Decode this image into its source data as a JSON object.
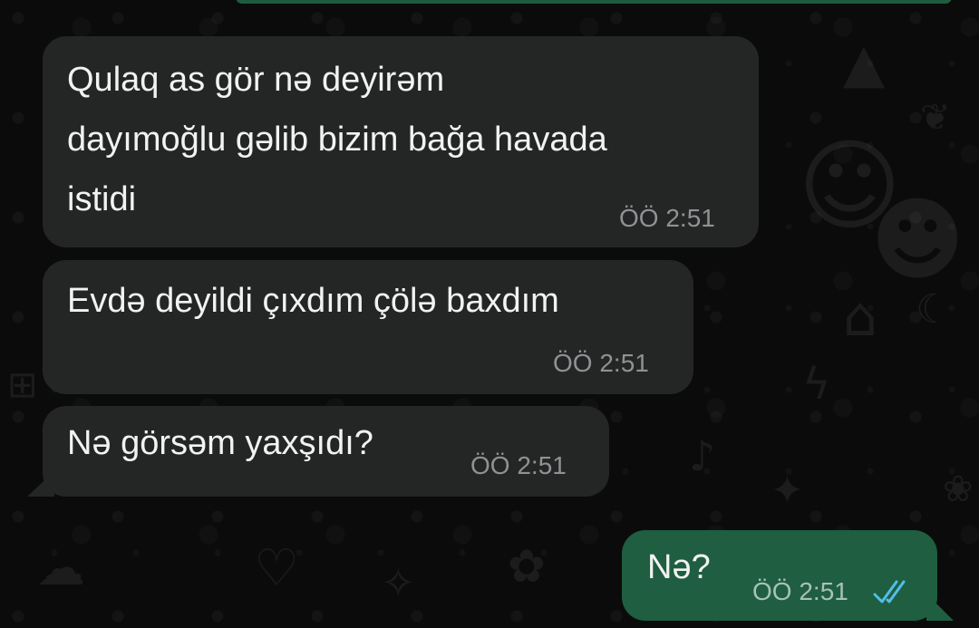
{
  "messages": [
    {
      "direction": "incoming",
      "lines": [
        "Qulaq as gör nə deyirəm",
        "dayımoğlu gəlib bizim bağa havada",
        "istidi"
      ],
      "time": "ÖÖ 2:51"
    },
    {
      "direction": "incoming",
      "lines": [
        "Evdə deyildi çıxdım çölə baxdım"
      ],
      "time": "ÖÖ 2:51"
    },
    {
      "direction": "incoming",
      "lines": [
        "Nə görsəm yaxşıdı?"
      ],
      "time": "ÖÖ 2:51"
    },
    {
      "direction": "outgoing",
      "lines": [
        "Nə?"
      ],
      "time": "ÖÖ 2:51",
      "status": "read"
    }
  ],
  "icons": {
    "read_receipt": "double-check-icon"
  },
  "colors": {
    "incoming_bubble": "#242626",
    "outgoing_bubble": "#1f5e40",
    "read_tick": "#53bdeb",
    "timestamp": "#8f9294"
  }
}
